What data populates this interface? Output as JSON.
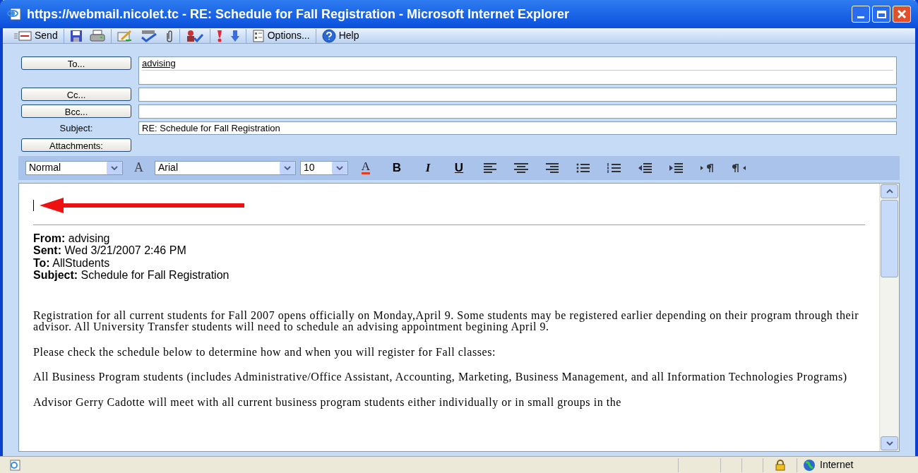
{
  "window": {
    "title": "https://webmail.nicolet.tc - RE: Schedule for Fall Registration - Microsoft Internet Explorer"
  },
  "toolbar": [
    {
      "kind": "send",
      "label": "Send"
    },
    {
      "kind": "save"
    },
    {
      "kind": "print"
    },
    {
      "kind": "edit"
    },
    {
      "kind": "spell"
    },
    {
      "kind": "attach"
    },
    {
      "kind": "names"
    },
    {
      "kind": "importance-high"
    },
    {
      "kind": "importance-low"
    },
    {
      "kind": "options",
      "label": "Options..."
    },
    {
      "kind": "help",
      "label": "Help"
    }
  ],
  "header": {
    "to": {
      "button": "To...",
      "value": "advising"
    },
    "cc": {
      "button": "Cc..."
    },
    "bcc": {
      "button": "Bcc..."
    },
    "subject": {
      "label": "Subject:",
      "value": "RE: Schedule for Fall Registration"
    },
    "attachments": {
      "button": "Attachments:"
    }
  },
  "format_bar": {
    "style": "Normal",
    "font_icon": "A",
    "font": "Arial",
    "size": "10",
    "buttons": [
      {
        "kind": "color",
        "label": "A"
      },
      {
        "kind": "bold",
        "label": "B"
      },
      {
        "kind": "italic",
        "label": "I"
      },
      {
        "kind": "underline",
        "label": "U"
      },
      {
        "kind": "align-left"
      },
      {
        "kind": "align-center"
      },
      {
        "kind": "align-right"
      },
      {
        "kind": "bullets"
      },
      {
        "kind": "numbers"
      },
      {
        "kind": "outdent"
      },
      {
        "kind": "indent"
      },
      {
        "kind": "ltr"
      },
      {
        "kind": "rtl"
      }
    ]
  },
  "body": {
    "quoted_header": [
      {
        "label": "From:",
        "value": "advising"
      },
      {
        "label": "Sent:",
        "value": "Wed 3/21/2007 2:46 PM"
      },
      {
        "label": "To:",
        "value": "AllStudents"
      },
      {
        "label": "Subject:",
        "value": "Schedule for Fall Registration"
      }
    ],
    "paragraphs": [
      "Registration for all current students for Fall 2007 opens officially on Monday,April 9. Some students may be registered earlier depending on their program through their advisor.  All University Transfer students will need to schedule an advising appointment begining April 9.",
      "Please check the schedule below to determine how and when you will register for Fall classes:",
      "All Business Program students (includes Administrative/Office Assistant, Accounting, Marketing, Business Management, and all Information Technologies Programs)",
      "Advisor Gerry Cadotte will meet with all current business program students either individually or in small groups in the"
    ]
  },
  "status_bar": {
    "zone": "Internet"
  }
}
